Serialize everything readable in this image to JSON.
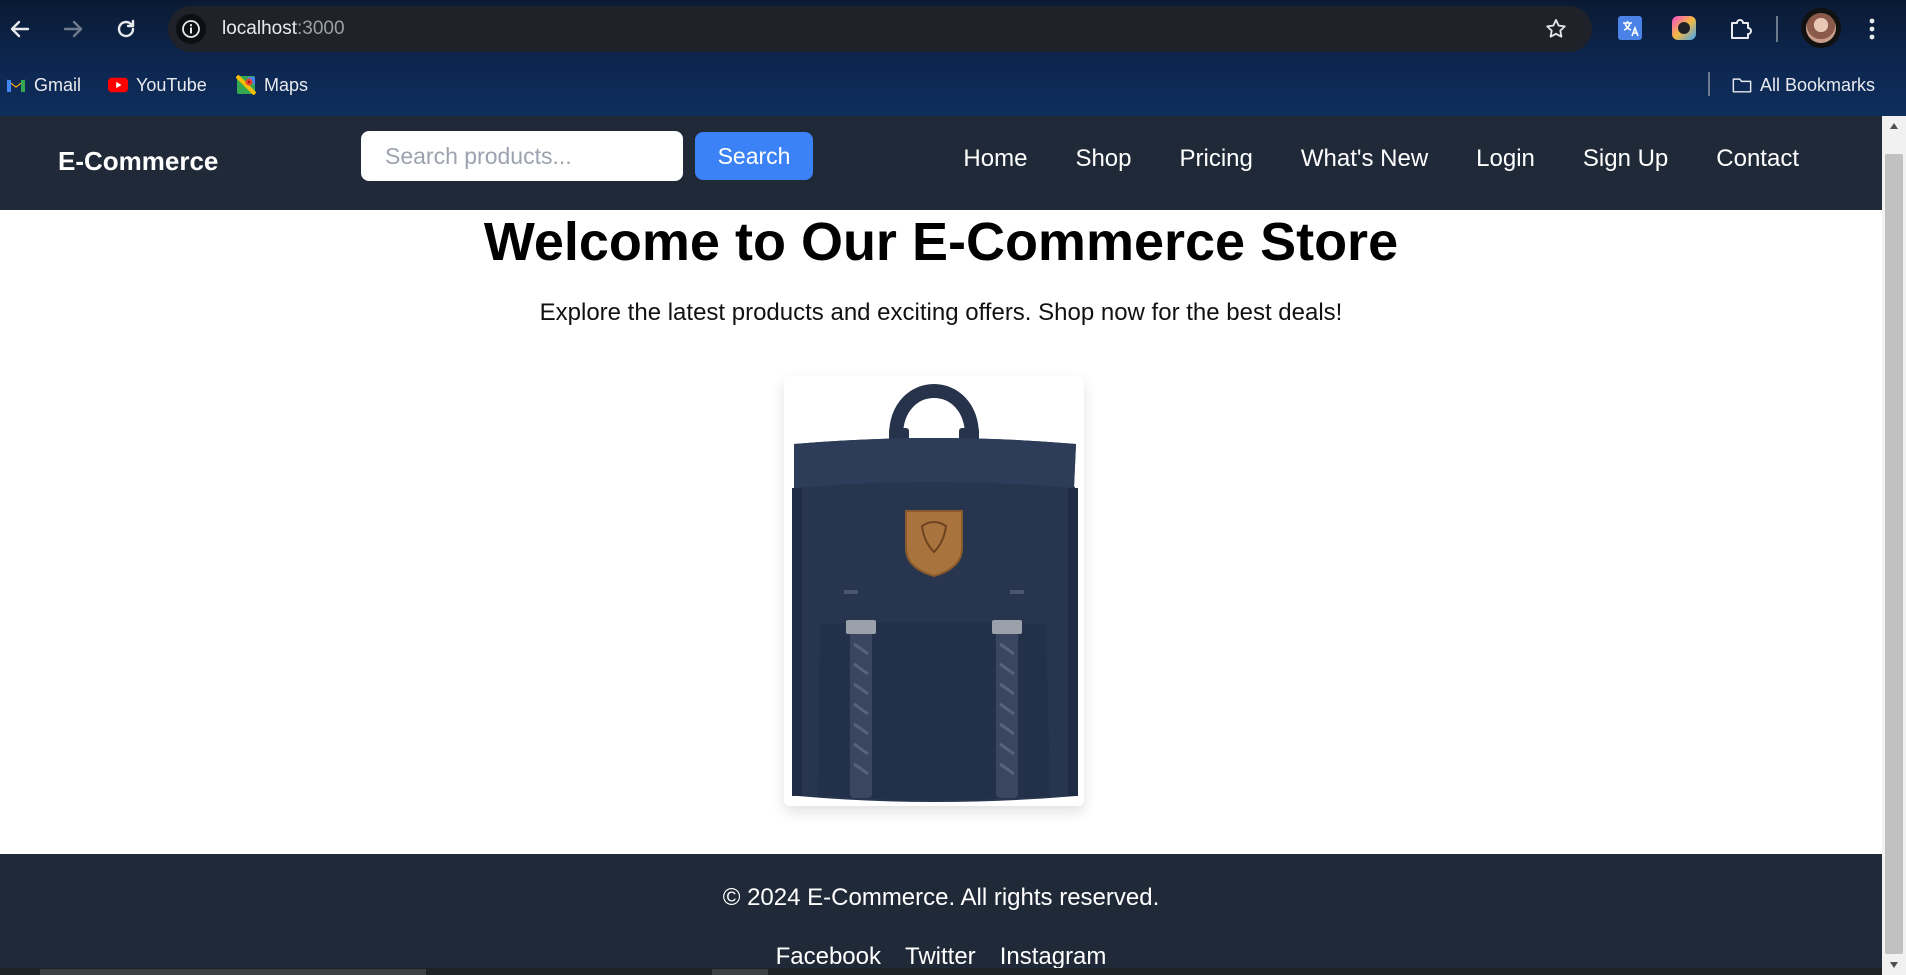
{
  "browser": {
    "url_host": "localhost",
    "url_port": ":3000",
    "icons": {
      "back": "arrow-left-icon",
      "forward": "arrow-right-icon",
      "reload": "reload-icon",
      "site_info": "info-icon",
      "bookmark_star": "star-icon",
      "menu": "kebab-menu-icon"
    },
    "extensions": [
      "translate-extension-icon",
      "color-extension-icon",
      "puzzle-extensions-icon"
    ],
    "bookmarks": [
      {
        "label": "Gmail",
        "icon": "gmail-icon"
      },
      {
        "label": "YouTube",
        "icon": "youtube-icon"
      },
      {
        "label": "Maps",
        "icon": "maps-icon"
      }
    ],
    "all_bookmarks": "All Bookmarks"
  },
  "site": {
    "brand": "E-Commerce",
    "search": {
      "placeholder": "Search products...",
      "button_label": "Search"
    },
    "nav": [
      {
        "label": "Home"
      },
      {
        "label": "Shop"
      },
      {
        "label": "Pricing"
      },
      {
        "label": "What's New"
      },
      {
        "label": "Login"
      },
      {
        "label": "Sign Up"
      },
      {
        "label": "Contact"
      }
    ]
  },
  "hero": {
    "title": "Welcome to Our E-Commerce Store",
    "subtitle": "Explore the latest products and exciting offers. Shop now for the best deals!"
  },
  "product": {
    "image": "navy-backpack-image"
  },
  "footer": {
    "copyright": "© 2024 E-Commerce. All rights reserved.",
    "social": [
      {
        "label": "Facebook"
      },
      {
        "label": "Twitter"
      },
      {
        "label": "Instagram"
      }
    ]
  },
  "colors": {
    "header_bg": "#1f2937",
    "accent": "#3b82f6",
    "backpack": "#27354f"
  }
}
